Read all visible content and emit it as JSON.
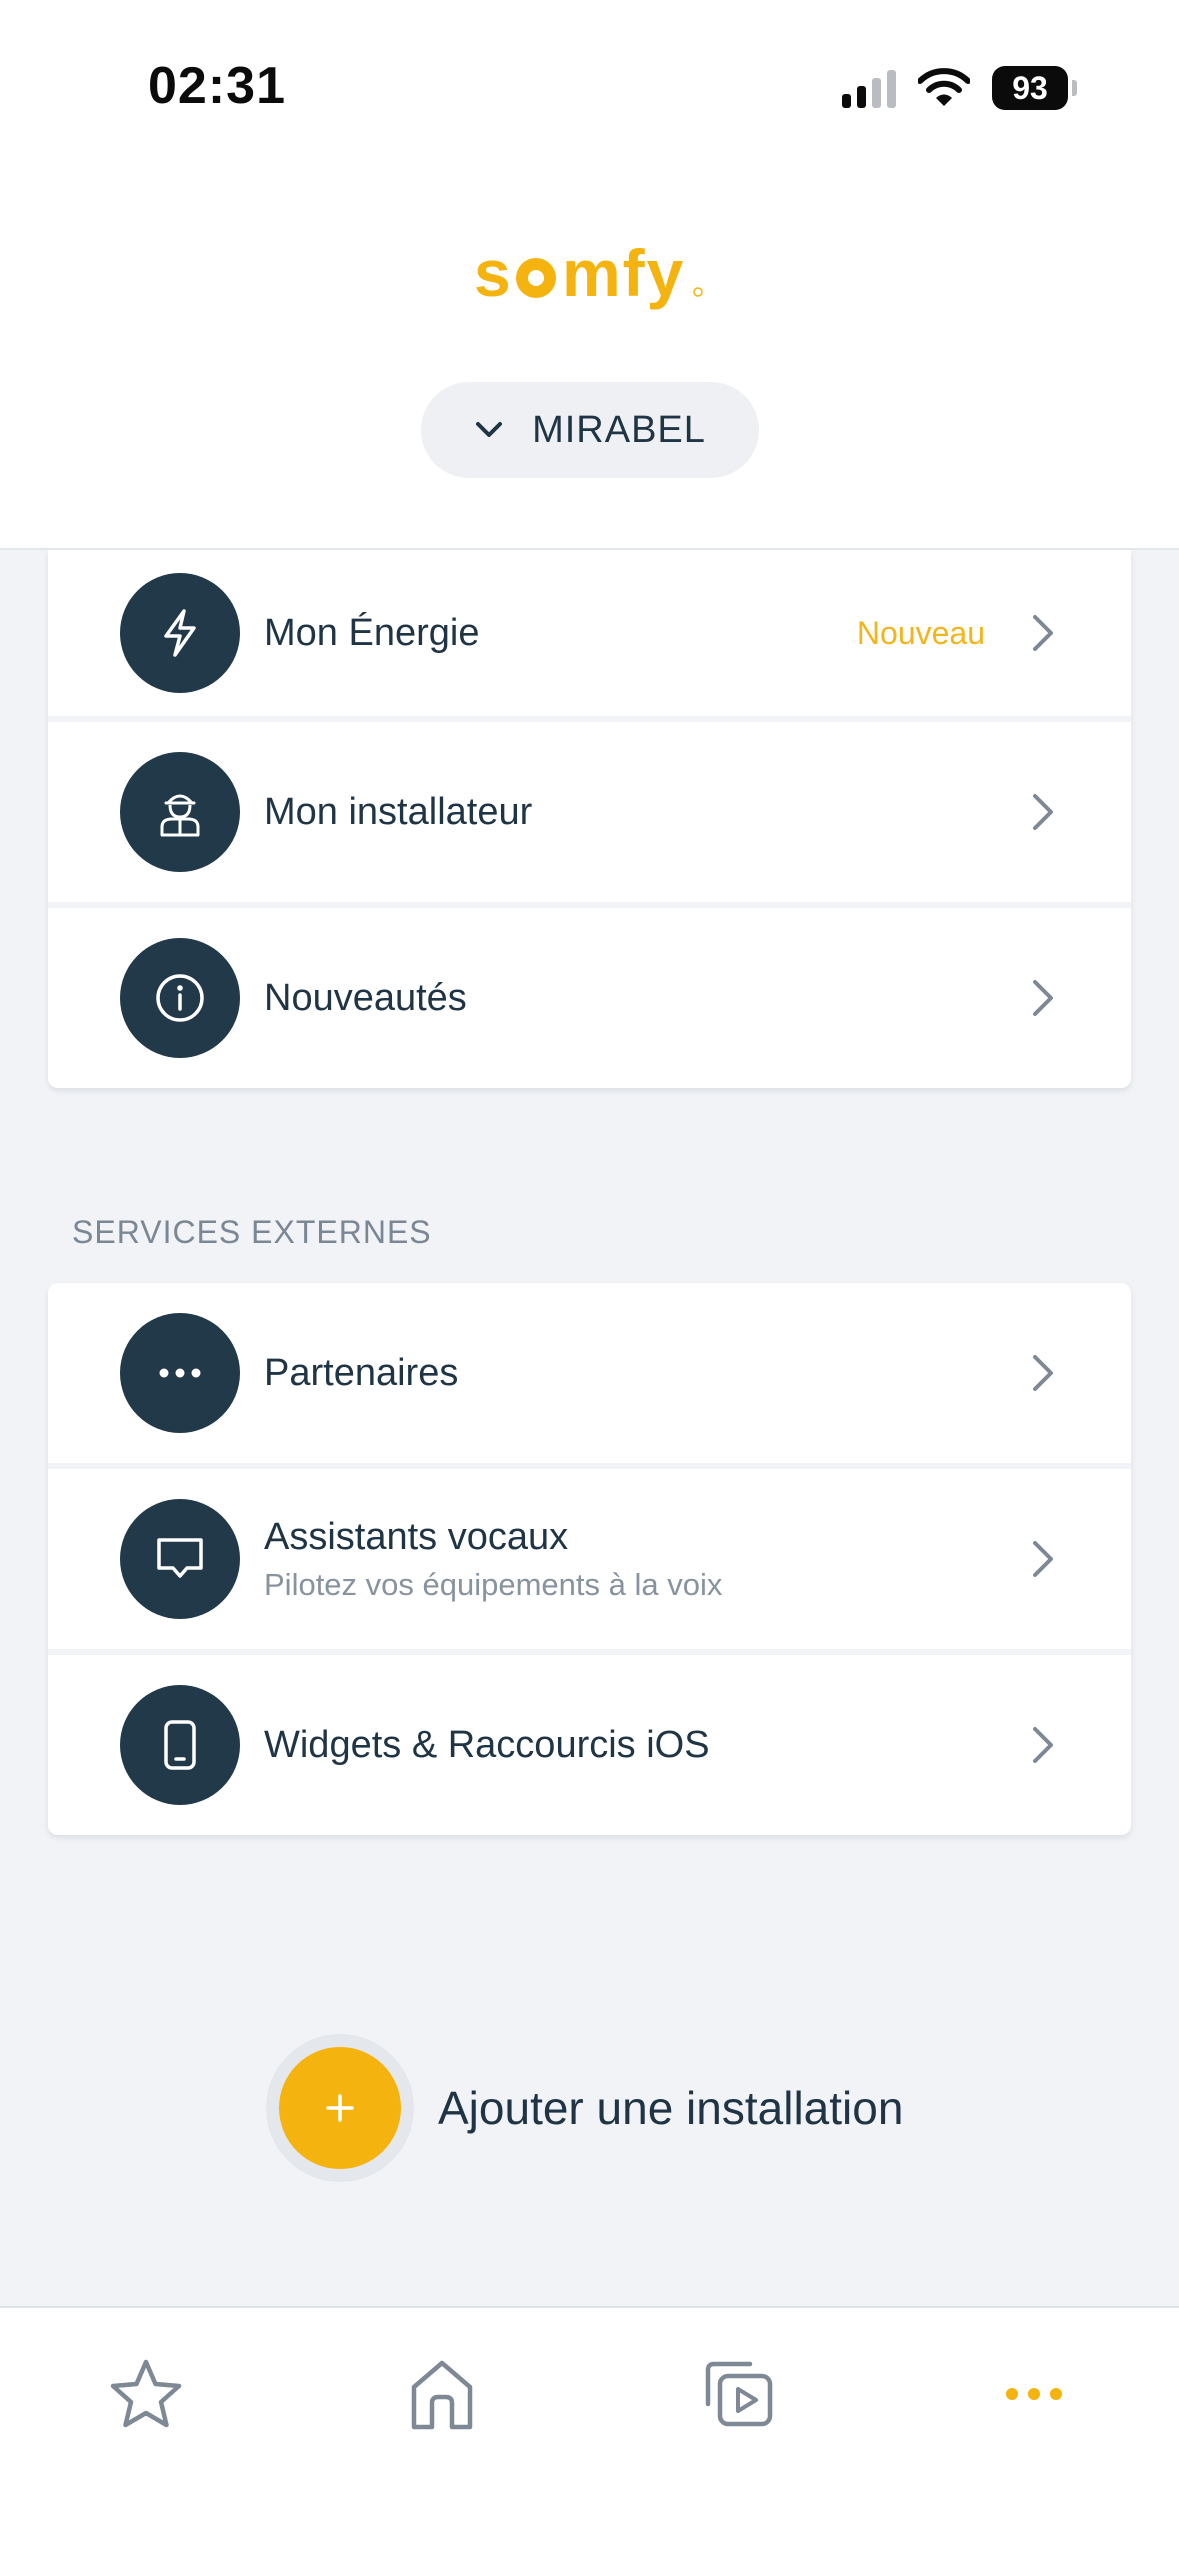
{
  "status_bar": {
    "time": "02:31",
    "battery": "93",
    "icons": [
      "cellular-signal-icon",
      "wifi-icon",
      "battery-icon"
    ]
  },
  "header": {
    "logo_text": "somfy",
    "site_selector": "MIRABEL"
  },
  "menu": {
    "items": [
      {
        "label": "Mon Énergie",
        "badge": "Nouveau",
        "icon": "lightning-icon"
      },
      {
        "label": "Mon installateur",
        "icon": "installer-icon"
      },
      {
        "label": "Nouveautés",
        "icon": "info-icon"
      }
    ]
  },
  "services": {
    "title": "SERVICES EXTERNES",
    "items": [
      {
        "label": "Partenaires",
        "icon": "more-dots-icon"
      },
      {
        "label": "Assistants vocaux",
        "subtitle": "Pilotez vos équipements à la voix",
        "icon": "speech-bubble-icon"
      },
      {
        "label": "Widgets & Raccourcis iOS",
        "icon": "phone-icon"
      }
    ]
  },
  "add_installation": {
    "label": "Ajouter une installation"
  },
  "tabbar": {
    "tabs": [
      {
        "icon": "star-icon",
        "active": false
      },
      {
        "icon": "home-icon",
        "active": false
      },
      {
        "icon": "scenarios-icon",
        "active": false
      },
      {
        "icon": "more-icon",
        "active": true
      }
    ]
  },
  "colors": {
    "accent": "#f5b30f",
    "dark_icon_bg": "#213949",
    "text": "#1f3444",
    "muted": "#8893a0",
    "background": "#f1f3f7"
  }
}
